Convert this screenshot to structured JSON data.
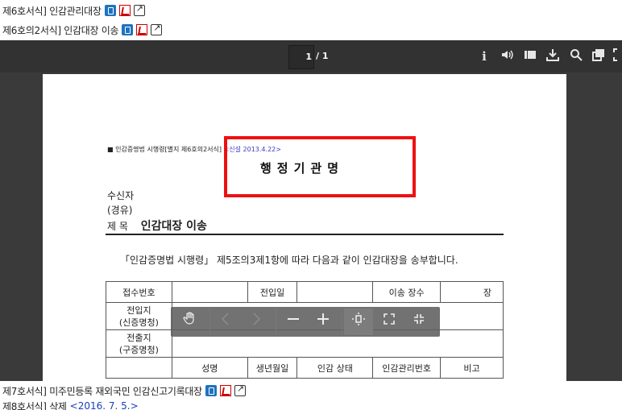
{
  "forms_top": [
    {
      "label": "제6호서식] 인감관리대장"
    },
    {
      "label": "제6호의2서식] 인감대장 이송"
    }
  ],
  "viewer": {
    "page_current": "1",
    "page_total": "/ 1",
    "toolbar_icons": [
      "info-icon",
      "volume-icon",
      "stack-icon",
      "download-icon",
      "search-icon",
      "copy-icon",
      "expand-icon"
    ],
    "document": {
      "ref_text": "■ 인감증명법 시행령[별지 제6호의2서식]",
      "ref_revision": "<신설 2013.4.22>",
      "agency_title": "행정기관명",
      "recipient_label": "수신자",
      "via_label": "(경유)",
      "subject_label": "제  목",
      "subject_value": "인감대장 이송",
      "body": "「인감증명법 시행령」 제5조의3제1항에 따라 다음과 같이 인감대장을 송부합니다.",
      "table": {
        "row1": {
          "receipt_no": "접수번호",
          "transfer_date": "전입일",
          "count_label": "이송 장수",
          "unit": "장"
        },
        "row2": {
          "label_line1": "전입지",
          "label_line2": "(신증명청)"
        },
        "row3": {
          "label_line1": "전출지",
          "label_line2": "(구증명청)"
        },
        "row4": {
          "name": "성명",
          "dob": "생년월일",
          "status": "인감 상태",
          "mgmt_no": "인감관리번호",
          "remarks": "비고"
        }
      }
    },
    "float_toolbar": {
      "icons": [
        "hand-icon",
        "prev-icon",
        "next-icon",
        "zoom-out-icon",
        "zoom-in-icon",
        "fit-page-icon",
        "fullscreen-icon",
        "exit-fullscreen-icon"
      ]
    }
  },
  "forms_bottom": [
    {
      "label": "제7호서식] 미주민등록 재외국민 인감신고기록대장"
    },
    {
      "label": "제8호서식] 삭제",
      "note": "<2016. 7. 5.>"
    }
  ],
  "colors": {
    "highlight": "#ee1111",
    "revision_link": "#3a3ac8",
    "download_icon": "#1e73be"
  }
}
